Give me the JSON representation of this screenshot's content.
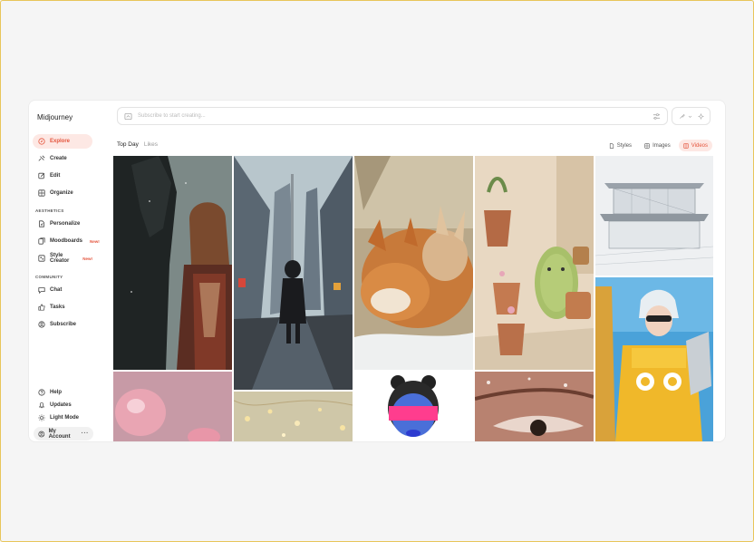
{
  "app": {
    "title": "Midjourney"
  },
  "sidebar": {
    "items": [
      {
        "label": "Explore",
        "icon": "compass-icon",
        "active": true
      },
      {
        "label": "Create",
        "icon": "create-icon"
      },
      {
        "label": "Edit",
        "icon": "edit-icon"
      },
      {
        "label": "Organize",
        "icon": "grid-icon"
      }
    ],
    "aesthetics_label": "AESTHETICS",
    "aesthetics": [
      {
        "label": "Personalize",
        "icon": "personalize-icon"
      },
      {
        "label": "Moodboards",
        "icon": "moodboard-icon",
        "badge": "New!"
      },
      {
        "label": "Style Creator",
        "icon": "palette-icon",
        "badge": "New!"
      }
    ],
    "community_label": "COMMUNITY",
    "community": [
      {
        "label": "Chat",
        "icon": "chat-icon"
      },
      {
        "label": "Tasks",
        "icon": "thumbs-up-icon"
      },
      {
        "label": "Subscribe",
        "icon": "user-circle-icon"
      }
    ],
    "bottom": [
      {
        "label": "Help",
        "icon": "help-icon"
      },
      {
        "label": "Updates",
        "icon": "bell-icon"
      },
      {
        "label": "Light Mode",
        "icon": "sun-icon"
      }
    ],
    "account": {
      "label": "My Account",
      "more": "···"
    }
  },
  "search": {
    "placeholder": "Subscribe to start creating..."
  },
  "tabs": {
    "active": "Top Day",
    "other": "Likes"
  },
  "filters": [
    {
      "label": "Styles",
      "icon": "styles-icon"
    },
    {
      "label": "Images",
      "icon": "images-icon"
    },
    {
      "label": "Videos",
      "icon": "video-icon",
      "active": true
    }
  ],
  "colors": {
    "accent": "#e4553d",
    "accent_bg": "#fde8e4"
  },
  "gallery": [
    {
      "name": "woman-with-horse-image"
    },
    {
      "name": "city-street-walker-image"
    },
    {
      "name": "sleeping-foxes-image"
    },
    {
      "name": "green-creature-plants-image"
    },
    {
      "name": "modern-house-sketch-image"
    },
    {
      "name": "pink-balloon-image"
    },
    {
      "name": "bokeh-lights-image"
    },
    {
      "name": "masked-figure-image"
    },
    {
      "name": "eye-closeup-image"
    },
    {
      "name": "anime-character-yellow-image"
    }
  ]
}
